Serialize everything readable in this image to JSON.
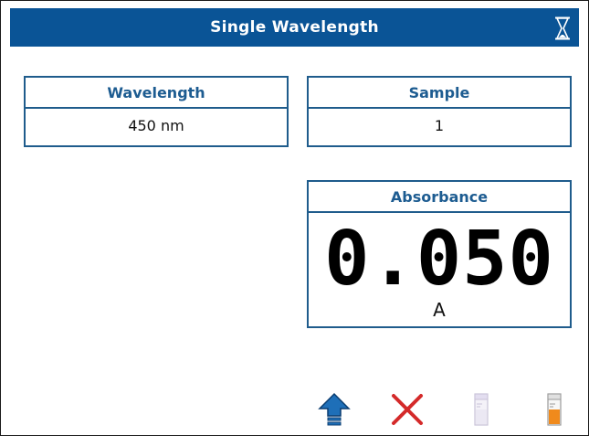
{
  "window": {
    "title": "Single Wavelength",
    "status_icon": "hourglass-icon"
  },
  "wavelength": {
    "label": "Wavelength",
    "value": "450 nm"
  },
  "sample": {
    "label": "Sample",
    "value": "1"
  },
  "absorbance": {
    "label": "Absorbance",
    "value": "0.050",
    "unit": "A"
  },
  "toolbar": {
    "items": [
      "up-arrow-icon",
      "cancel-x-icon",
      "sample-vial-icon",
      "blank-vial-icon"
    ]
  },
  "colors": {
    "title_bar": "#0a5496",
    "label_text": "#1d5c91",
    "cancel_red": "#d42a2a",
    "arrow_blue": "#1e6fb8",
    "vial_orange": "#f08a1c"
  }
}
